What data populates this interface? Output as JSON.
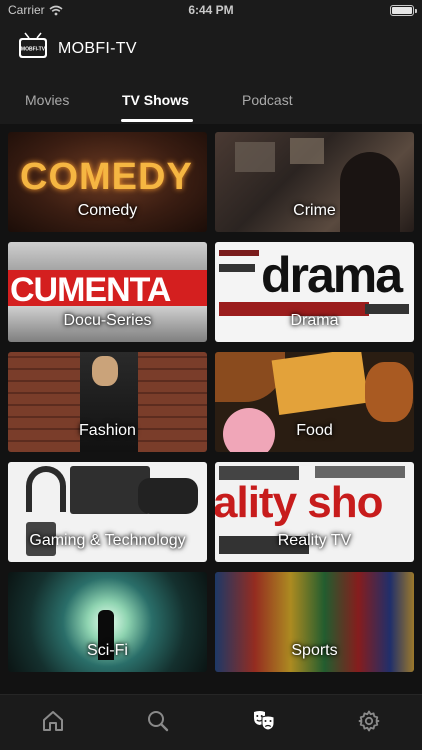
{
  "status_bar": {
    "carrier": "Carrier",
    "time": "6:44 PM",
    "battery_level": 1.0
  },
  "header": {
    "logo_text": "MOBFI-TV",
    "title": "MOBFI-TV"
  },
  "tabs": [
    {
      "label": "Movies",
      "active": false
    },
    {
      "label": "TV Shows",
      "active": true
    },
    {
      "label": "Podcast",
      "active": false
    }
  ],
  "categories": [
    {
      "label": "Comedy",
      "art_text": "COMEDY"
    },
    {
      "label": "Crime"
    },
    {
      "label": "Docu-Series",
      "art_text": "CUMENTA"
    },
    {
      "label": "Drama",
      "art_text": "drama"
    },
    {
      "label": "Fashion"
    },
    {
      "label": "Food"
    },
    {
      "label": "Gaming & Technology"
    },
    {
      "label": "Reality TV",
      "art_text": "ality sho"
    },
    {
      "label": "Sci-Fi"
    },
    {
      "label": "Sports"
    }
  ],
  "bottom_nav": [
    {
      "icon": "home-icon",
      "active": false
    },
    {
      "icon": "search-icon",
      "active": false
    },
    {
      "icon": "theater-masks-icon",
      "active": true
    },
    {
      "icon": "settings-gear-icon",
      "active": false
    }
  ],
  "colors": {
    "background": "#121212",
    "bar": "#1b1b1b",
    "active": "#ffffff",
    "inactive": "#8a8a8a",
    "comedy_yellow": "#f5b642"
  }
}
